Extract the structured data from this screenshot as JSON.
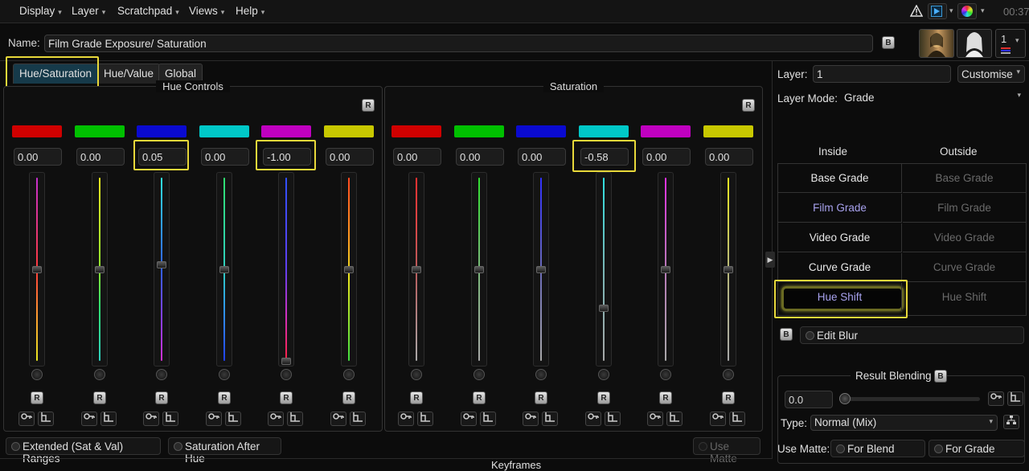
{
  "menubar": {
    "items": [
      "Display",
      "Layer",
      "Scratchpad",
      "Views",
      "Help"
    ],
    "clock": "00:37",
    "buttons": [
      "warning-icon",
      "play-icon",
      "color-wheel-icon"
    ]
  },
  "header": {
    "name_label": "Name:",
    "name_value": "Film Grade Exposure/ Saturation",
    "b_button": "B",
    "thumb_counter": "1"
  },
  "tabs": [
    "Hue/Saturation",
    "Hue/Value",
    "Global"
  ],
  "active_tab": "Hue/Saturation",
  "hue_panel": {
    "title": "Hue Controls",
    "reset": "R",
    "channels": [
      {
        "color": "#d00000",
        "value": "0.00",
        "line": "linear-gradient(#c62fd0,#ff3a3a 50%,#ff9a30 75%,#e8e820)",
        "level": 0.5
      },
      {
        "color": "#00c000",
        "value": "0.00",
        "line": "linear-gradient(#e8e820,#8fe830 50%,#30e070 70%,#30d0c0)",
        "level": 0.5
      },
      {
        "color": "#0a0ad0",
        "value": "0.05",
        "line": "linear-gradient(#30e0e0,#3060ff 50%,#8040f0 75%,#d030d0)",
        "level": 0.525
      },
      {
        "color": "#00c8c8",
        "value": "0.00",
        "line": "linear-gradient(#30e070,#30d0c0 50%,#3080ff 80%,#2040ff)",
        "level": 0.5
      },
      {
        "color": "#c000c0",
        "value": "-1.00",
        "line": "linear-gradient(#3050ff,#6040f0 50%,#d030c0 75%,#ff2040)",
        "level": 0.0
      },
      {
        "color": "#c8c800",
        "value": "0.00",
        "line": "linear-gradient(#ff4a20,#ffa020 35%,#e8e820 55%,#40e040)",
        "level": 0.5
      }
    ]
  },
  "sat_panel": {
    "title": "Saturation",
    "reset": "R",
    "channels": [
      {
        "color": "#d00000",
        "value": "0.00",
        "line": "linear-gradient(#ff3030,#b85a5a 50%,#a8a8a8)",
        "level": 0.5
      },
      {
        "color": "#00c000",
        "value": "0.00",
        "line": "linear-gradient(#30e030,#7ab87a 50%,#a8a8a8)",
        "level": 0.5
      },
      {
        "color": "#0a0ad0",
        "value": "0.00",
        "line": "linear-gradient(#3030ff,#6a6ab8 50%,#a8a8a8)",
        "level": 0.5
      },
      {
        "color": "#00c8c8",
        "value": "-0.58",
        "line": "linear-gradient(#30e0e0,#7ab8b8 50%,#a8a8a8)",
        "level": 0.29
      },
      {
        "color": "#c000c0",
        "value": "0.00",
        "line": "linear-gradient(#e030e0,#b87ab8 50%,#a8a8a8)",
        "level": 0.5
      },
      {
        "color": "#c8c800",
        "value": "0.00",
        "line": "linear-gradient(#e8e820,#b8b87a 50%,#a8a8a8)",
        "level": 0.5
      }
    ]
  },
  "bottom": {
    "extended_ranges": "Extended (Sat & Val) Ranges",
    "sat_after_hue": "Saturation After Hue",
    "use_matte": "Use Matte",
    "keyframes": "Keyframes"
  },
  "right": {
    "layer_label": "Layer:",
    "layer_value": "1",
    "customise": "Customise",
    "layer_mode_label": "Layer Mode:",
    "layer_mode_value": "Grade",
    "inside": "Inside",
    "outside": "Outside",
    "grid": [
      {
        "in": "Base Grade",
        "out": "Base Grade"
      },
      {
        "in": "Film Grade",
        "out": "Film Grade"
      },
      {
        "in": "Video Grade",
        "out": "Video Grade"
      },
      {
        "in": "Curve Grade",
        "out": "Curve Grade"
      },
      {
        "in": "Hue Shift",
        "out": "Hue Shift"
      }
    ],
    "b_button": "B",
    "edit_blur": "Edit Blur",
    "result_blending": "Result Blending",
    "blend_value": "0.0",
    "type_label": "Type:",
    "type_value": "Normal (Mix)",
    "use_matte_label": "Use Matte:",
    "for_blend": "For Blend",
    "for_grade": "For Grade"
  }
}
